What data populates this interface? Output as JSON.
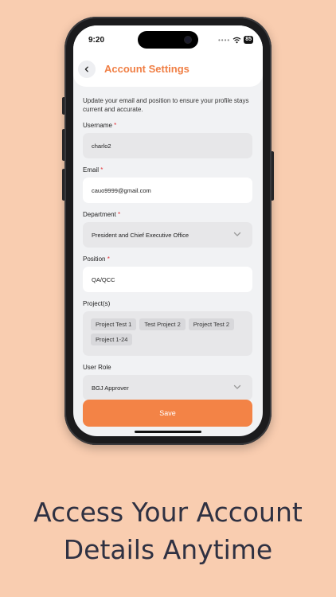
{
  "status": {
    "time": "9:20",
    "battery": "85"
  },
  "header": {
    "title": "Account Settings"
  },
  "intro": "Update your email and position to ensure your profile stays current and accurate.",
  "form": {
    "username": {
      "label": "Username",
      "required": "*",
      "value": "charlo2"
    },
    "email": {
      "label": "Email",
      "required": "*",
      "value": "cauo9999@gmail.com"
    },
    "department": {
      "label": "Department",
      "required": "*",
      "value": "President and Chief Executive Office"
    },
    "position": {
      "label": "Position",
      "required": "*",
      "value": "QA/QCC"
    },
    "projects": {
      "label": "Project(s)",
      "items": [
        "Project Test 1",
        "Test Project 2",
        "Project Test 2",
        "Project 1-24"
      ]
    },
    "user_role": {
      "label": "User Role",
      "value": "BGJ Approver"
    }
  },
  "save_label": "Save",
  "tagline": {
    "line1": "Access Your Account",
    "line2": "Details Anytime"
  },
  "colors": {
    "background": "#F9CDB0",
    "accent": "#F38346",
    "title": "#F07F45",
    "required": "#E3343A"
  },
  "icons": {
    "back": "chevron-left-icon",
    "dropdown": "chevron-down-icon",
    "wifi": "wifi-icon"
  }
}
